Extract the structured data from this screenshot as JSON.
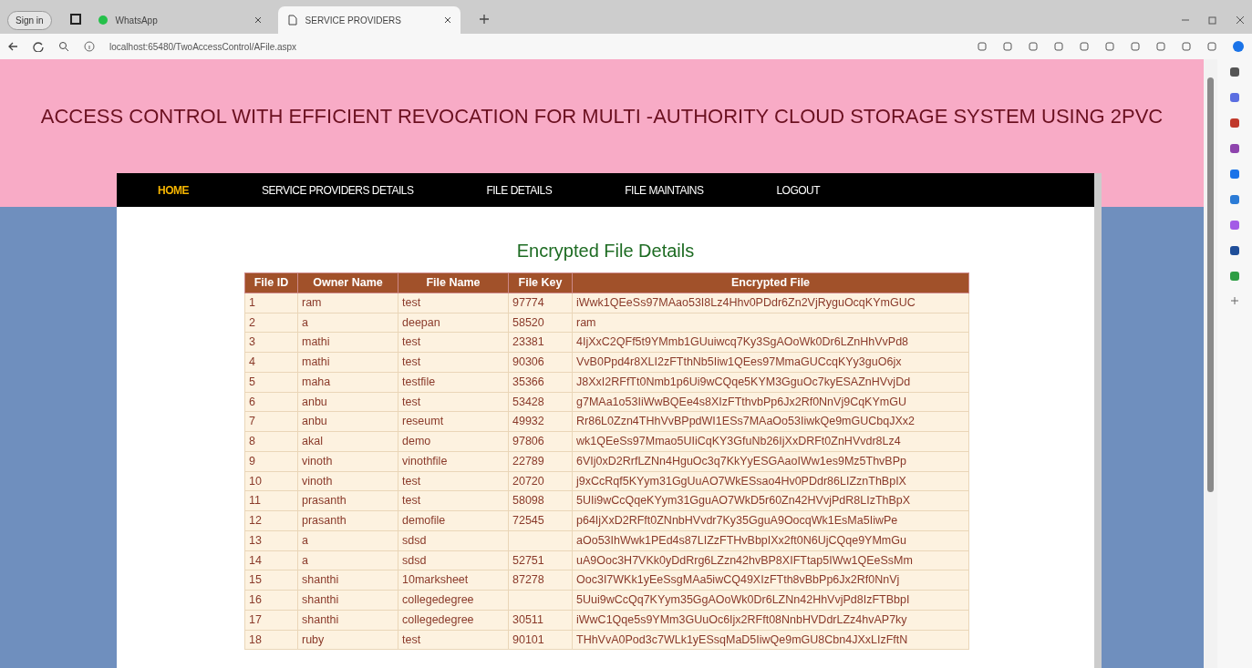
{
  "browser": {
    "profile_button": "Sign in",
    "tabs": [
      {
        "title": "WhatsApp",
        "selected": false,
        "kind": "whatsapp"
      },
      {
        "title": "SERVICE PROVIDERS",
        "selected": true,
        "kind": "page"
      }
    ],
    "address": "localhost:65480/TwoAccessControl/AFile.aspx"
  },
  "page": {
    "title": "ACCESS CONTROL WITH EFFICIENT REVOCATION FOR MULTI -AUTHORITY CLOUD STORAGE SYSTEM USING 2PVC",
    "nav": [
      {
        "label": "HOME",
        "selected": true
      },
      {
        "label": "SERVICE PROVIDERS DETAILS",
        "selected": false
      },
      {
        "label": "FILE DETAILS",
        "selected": false
      },
      {
        "label": "FILE MAINTAINS",
        "selected": false
      },
      {
        "label": "LOGOUT",
        "selected": false
      }
    ],
    "heading": "Encrypted File Details",
    "table": {
      "columns": [
        "File ID",
        "Owner Name",
        "File Name",
        "File Key",
        "Encrypted File"
      ],
      "rows": [
        [
          "1",
          "ram",
          "test",
          "97774",
          "iWwk1QEeSs97MAao53I8Lz4Hhv0PDdr6Zn2VjRyguOcqKYmGUC"
        ],
        [
          "2",
          "a",
          "deepan",
          "58520",
          "ram"
        ],
        [
          "3",
          "mathi",
          "test",
          "23381",
          "4IjXxC2QFf5t9YMmb1GUuiwcq7Ky3SgAOoWk0Dr6LZnHhVvPd8"
        ],
        [
          "4",
          "mathi",
          "test",
          "90306",
          "VvB0Ppd4r8XLI2zFTthNb5Iiw1QEes97MmaGUCcqKYy3guO6jx"
        ],
        [
          "5",
          "maha",
          "testfile",
          "35366",
          "J8XxI2RFfTt0Nmb1p6Ui9wCQqe5KYM3GguOc7kyESAZnHVvjDd"
        ],
        [
          "6",
          "anbu",
          "test",
          "53428",
          "g7MAa1o53IiWwBQEe4s8XIzFTthvbPp6Jx2Rf0NnVj9CqKYmGU"
        ],
        [
          "7",
          "anbu",
          "reseumt",
          "49932",
          "Rr86L0Zzn4THhVvBPpdWI1ESs7MAaOo53IiwkQe9mGUCbqJXx2"
        ],
        [
          "8",
          "akal",
          "demo",
          "97806",
          "wk1QEeSs97Mmao5UIiCqKY3GfuNb26IjXxDRFt0ZnHVvdr8Lz4"
        ],
        [
          "9",
          "vinoth",
          "vinothfile",
          "22789",
          "6VIj0xD2RrfLZNn4HguOc3q7KkYyESGAaoIWw1es9Mz5ThvBPp"
        ],
        [
          "10",
          "vinoth",
          "test",
          "20720",
          "j9xCcRqf5KYym31GgUuAO7WkESsao4Hv0PDdr86LIZznThBpIX"
        ],
        [
          "11",
          "prasanth",
          "test",
          "58098",
          "5UIi9wCcQqeKYym31GguAO7WkD5r60Zn42HVvjPdR8LIzThBpX"
        ],
        [
          "12",
          "prasanth",
          "demofile",
          "72545",
          "p64IjXxD2RFft0ZNnbHVvdr7Ky35GguA9OocqWk1EsMa5IiwPe"
        ],
        [
          "13",
          "a",
          "sdsd",
          "",
          "aOo53IhWwk1PEd4s87LIZzFTHvBbpIXx2ft0N6UjCQqe9YMmGu"
        ],
        [
          "14",
          "a",
          "sdsd",
          "52751",
          "uA9Ooc3H7VKk0yDdRrg6LZzn42hvBP8XIFTtap5IWw1QEeSsMm"
        ],
        [
          "15",
          "shanthi",
          "10marksheet",
          "87278",
          "Ooc3I7WKk1yEeSsgMAa5iwCQ49XIzFTth8vBbPp6Jx2Rf0NnVj"
        ],
        [
          "16",
          "shanthi",
          "collegedegree",
          "",
          "5Uui9wCcQq7KYym35GgAOoWk0Dr6LZNn42HhVvjPd8IzFTBbpI"
        ],
        [
          "17",
          "shanthi",
          "collegedegree",
          "30511",
          "iWwC1Qqe5s9YMm3GUuOc6Ijx2RFft08NnbHVDdrLZz4hvAP7ky"
        ],
        [
          "18",
          "ruby",
          "test",
          "90101",
          "THhVvA0Pod3c7WLk1yESsqMaD5IiwQe9mGU8Cbn4JXxLIzFftN"
        ]
      ]
    }
  }
}
